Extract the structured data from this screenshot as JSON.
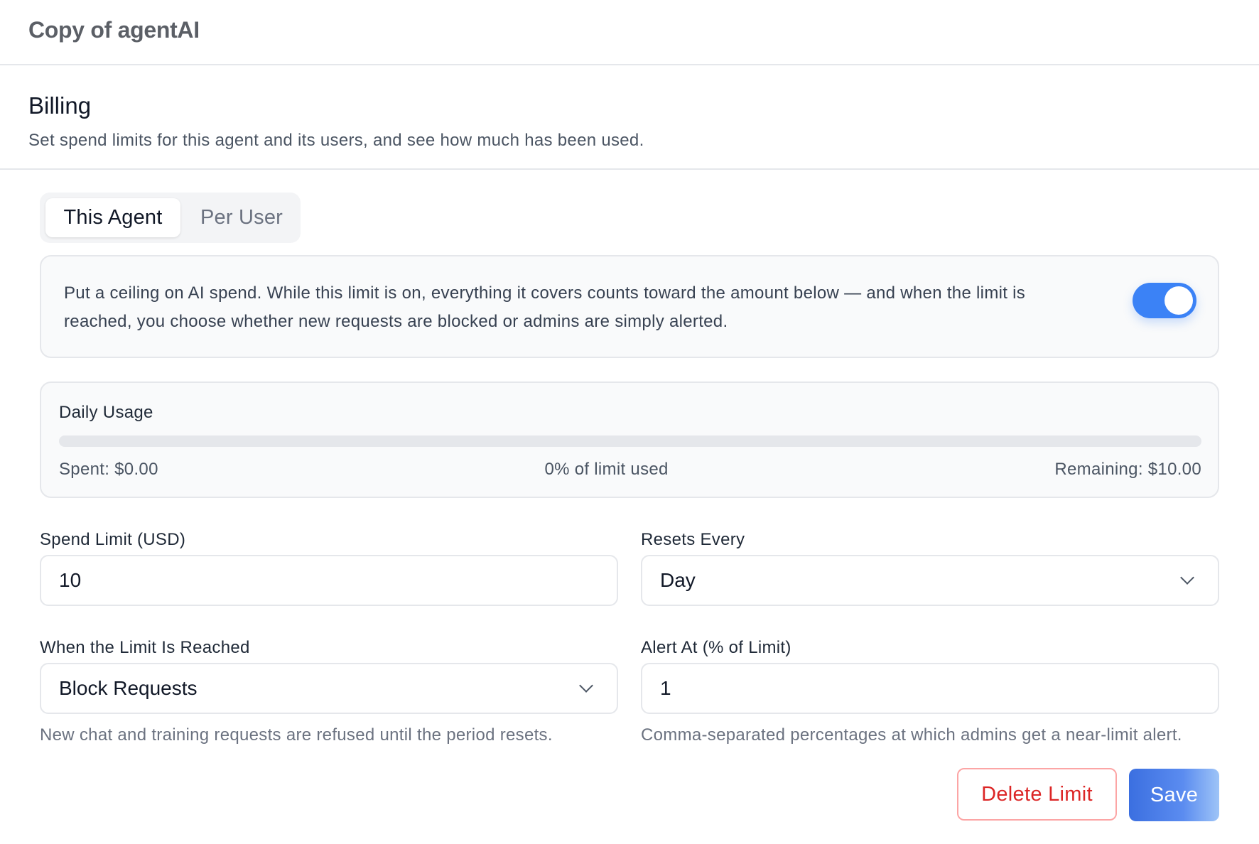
{
  "app": {
    "title": "Copy of agentAI"
  },
  "billing": {
    "title": "Billing",
    "description": "Set spend limits for this agent and its users, and see how much has been used."
  },
  "tabs": [
    {
      "label": "This Agent",
      "active": true
    },
    {
      "label": "Per User",
      "active": false
    }
  ],
  "limit_info": {
    "text": "Put a ceiling on AI spend. While this limit is on, everything it covers counts toward the amount below — and when the limit is reached, you choose whether new requests are blocked or admins are simply alerted.",
    "enabled": true
  },
  "usage": {
    "title": "Daily Usage",
    "spent": "Spent: $0.00",
    "percent_text": "0% of limit used",
    "remaining": "Remaining: $10.00",
    "fraction_used": 0
  },
  "form": {
    "spend_limit": {
      "label": "Spend Limit (USD)",
      "value": "10"
    },
    "resets_every": {
      "label": "Resets Every",
      "value": "Day"
    },
    "when_reached": {
      "label": "When the Limit Is Reached",
      "value": "Block Requests",
      "helper": "New chat and training requests are refused until the period resets."
    },
    "alert_at": {
      "label": "Alert At (% of Limit)",
      "value": "1",
      "helper": "Comma-separated percentages at which admins get a near-limit alert."
    }
  },
  "actions": {
    "delete_label": "Delete Limit",
    "save_label": "Save"
  },
  "colors": {
    "accent": "#3b82f6",
    "danger": "#dc2626"
  },
  "icons": {
    "select_chevron": "chevron-down-icon"
  }
}
